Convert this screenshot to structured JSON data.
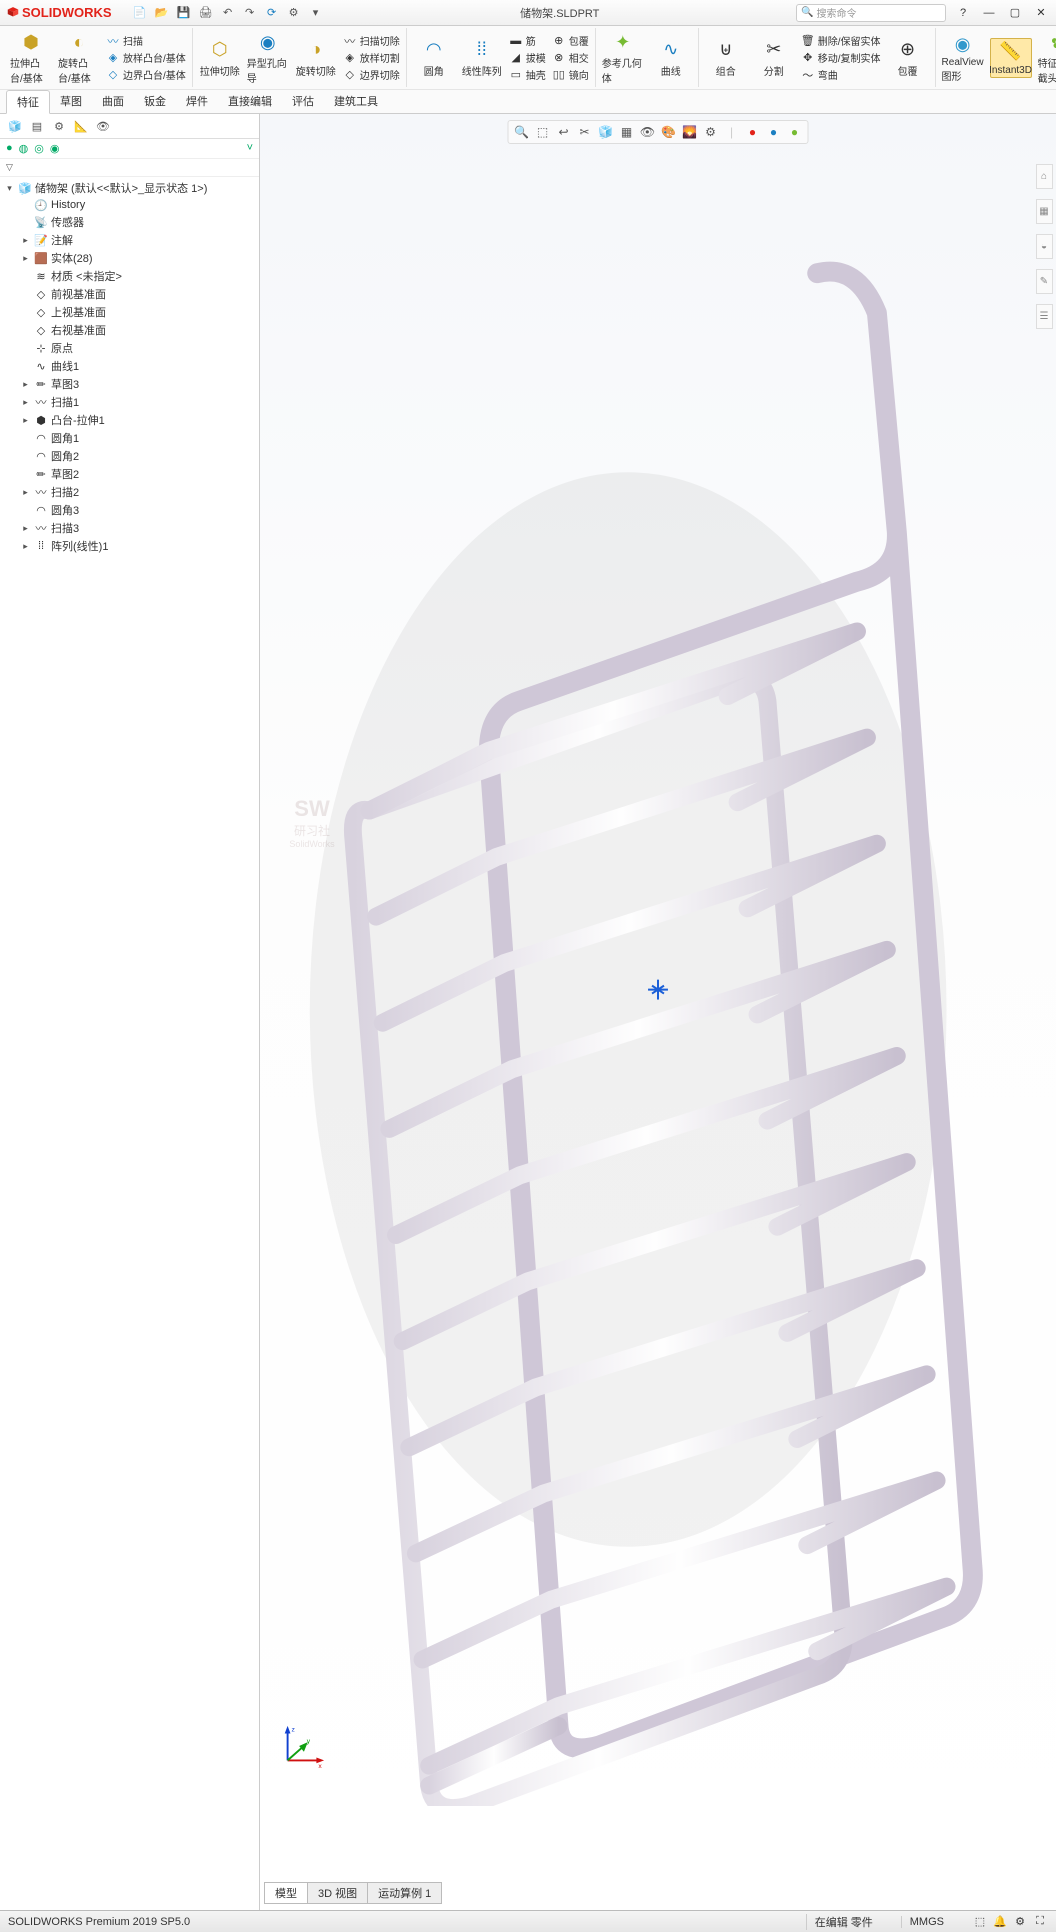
{
  "app": {
    "name": "SOLIDWORKS",
    "docTitle": "储物架.SLDPRT",
    "searchPlaceholder": "搜索命令"
  },
  "ribbon": {
    "tabs": [
      "特征",
      "草图",
      "曲面",
      "钣金",
      "焊件",
      "直接编辑",
      "评估",
      "建筑工具"
    ],
    "activeTab": 0,
    "big1": {
      "a": "拉伸凸台/基体",
      "b": "旋转凸台/基体"
    },
    "grp1": [
      "扫描",
      "放样凸台/基体",
      "边界凸台/基体"
    ],
    "big2": {
      "a": "拉伸切除",
      "sub": "异型孔向导",
      "b": "旋转切除"
    },
    "grp2": [
      "扫描切除",
      "放样切割",
      "边界切除"
    ],
    "big3": [
      "圆角",
      "线性阵列"
    ],
    "grp3": [
      "筋",
      "拔模",
      "抽壳"
    ],
    "grp3b": [
      "包覆",
      "相交",
      "镜向"
    ],
    "big4": "参考几何体",
    "big5": "曲线",
    "big6": [
      "组合",
      "分割"
    ],
    "grp6": [
      "删除/保留实体",
      "移动/复制实体",
      "弯曲",
      "包覆"
    ],
    "realview": "RealView 图形",
    "instant3d": "Instant3D",
    "featname": "特征名裁截头"
  },
  "featureTree": {
    "root": "储物架 (默认<<默认>_显示状态 1>)",
    "nodes": [
      {
        "label": "History",
        "icon": "history",
        "depth": 1
      },
      {
        "label": "传感器",
        "icon": "sensor",
        "depth": 1
      },
      {
        "label": "注解",
        "icon": "anno",
        "depth": 1,
        "exp": "▸"
      },
      {
        "label": "实体(28)",
        "icon": "solid",
        "depth": 1,
        "exp": "▸"
      },
      {
        "label": "材质 <未指定>",
        "icon": "mat",
        "depth": 1
      },
      {
        "label": "前视基准面",
        "icon": "plane",
        "depth": 1
      },
      {
        "label": "上视基准面",
        "icon": "plane",
        "depth": 1
      },
      {
        "label": "右视基准面",
        "icon": "plane",
        "depth": 1
      },
      {
        "label": "原点",
        "icon": "origin",
        "depth": 1
      },
      {
        "label": "曲线1",
        "icon": "curve",
        "depth": 1
      },
      {
        "label": "草图3",
        "icon": "sketch",
        "depth": 1,
        "exp": "▸"
      },
      {
        "label": "扫描1",
        "icon": "sweep",
        "depth": 1,
        "exp": "▸"
      },
      {
        "label": "凸台-拉伸1",
        "icon": "extrude",
        "depth": 1,
        "exp": "▸"
      },
      {
        "label": "圆角1",
        "icon": "fillet",
        "depth": 1
      },
      {
        "label": "圆角2",
        "icon": "fillet",
        "depth": 1
      },
      {
        "label": "草图2",
        "icon": "sketch",
        "depth": 1
      },
      {
        "label": "扫描2",
        "icon": "sweep",
        "depth": 1,
        "exp": "▸"
      },
      {
        "label": "圆角3",
        "icon": "fillet",
        "depth": 1
      },
      {
        "label": "扫描3",
        "icon": "sweep",
        "depth": 1,
        "exp": "▸"
      },
      {
        "label": "阵列(线性)1",
        "icon": "pattern",
        "depth": 1,
        "exp": "▸"
      }
    ]
  },
  "bottomTabs": [
    "模型",
    "3D 视图",
    "运动算例 1"
  ],
  "status": {
    "left": "SOLIDWORKS Premium 2019 SP5.0",
    "mode": "在编辑 零件",
    "units": "MMGS"
  },
  "watermark": {
    "big": "SW",
    "line1": "研习社",
    "line2": "SolidWorks"
  }
}
